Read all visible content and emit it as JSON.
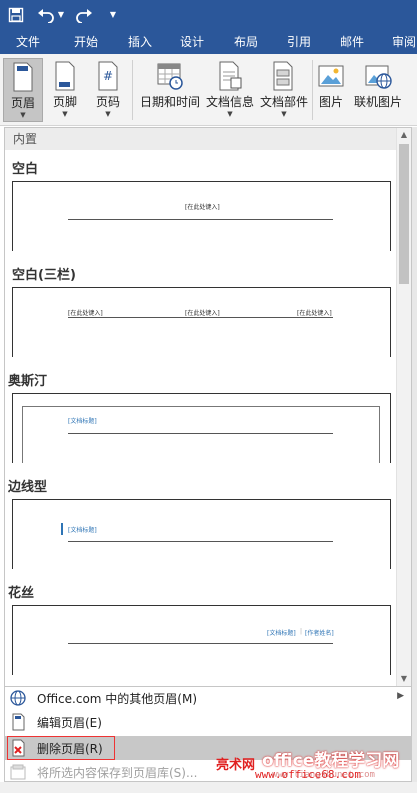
{
  "tabs": [
    "文件",
    "开始",
    "插入",
    "设计",
    "布局",
    "引用",
    "邮件",
    "审阅"
  ],
  "ribbon": {
    "header": "页眉",
    "footer": "页脚",
    "page_number": "页码",
    "datetime": "日期和时间",
    "docinfo": "文档信息",
    "docparts": "文档部件",
    "picture": "图片",
    "online_picture": "联机图片",
    "page_number_glyph": "#"
  },
  "gallery": {
    "header": "内置",
    "sections": [
      {
        "title": "空白",
        "placeholders": [
          "[在此处键入]"
        ]
      },
      {
        "title": "空白(三栏)",
        "placeholders": [
          "[在此处键入]",
          "[在此处键入]",
          "[在此处键入]"
        ]
      },
      {
        "title": "奥斯汀",
        "placeholders": [
          "[文档标题]"
        ]
      },
      {
        "title": "边线型",
        "placeholders": [
          "[文档标题]"
        ]
      },
      {
        "title": "花丝",
        "placeholders": [
          "[文档标题]",
          "[作者姓名]"
        ]
      }
    ]
  },
  "menu": {
    "more": "Office.com 中的其他页眉(M)",
    "edit": "编辑页眉(E)",
    "remove": "删除页眉(R)",
    "save": "将所选内容保存到页眉库(S)..."
  },
  "watermark": {
    "brand": "亮术网",
    "site_cn": "office教程学习网",
    "url": "www.office68.com",
    "url_partial": "www.liangshunet.com"
  },
  "colors": {
    "title_blue": "#2b579a",
    "ribbon_bg": "#f3f3f3",
    "highlight": "#c8c8c8",
    "remove_box": "#e33333"
  }
}
